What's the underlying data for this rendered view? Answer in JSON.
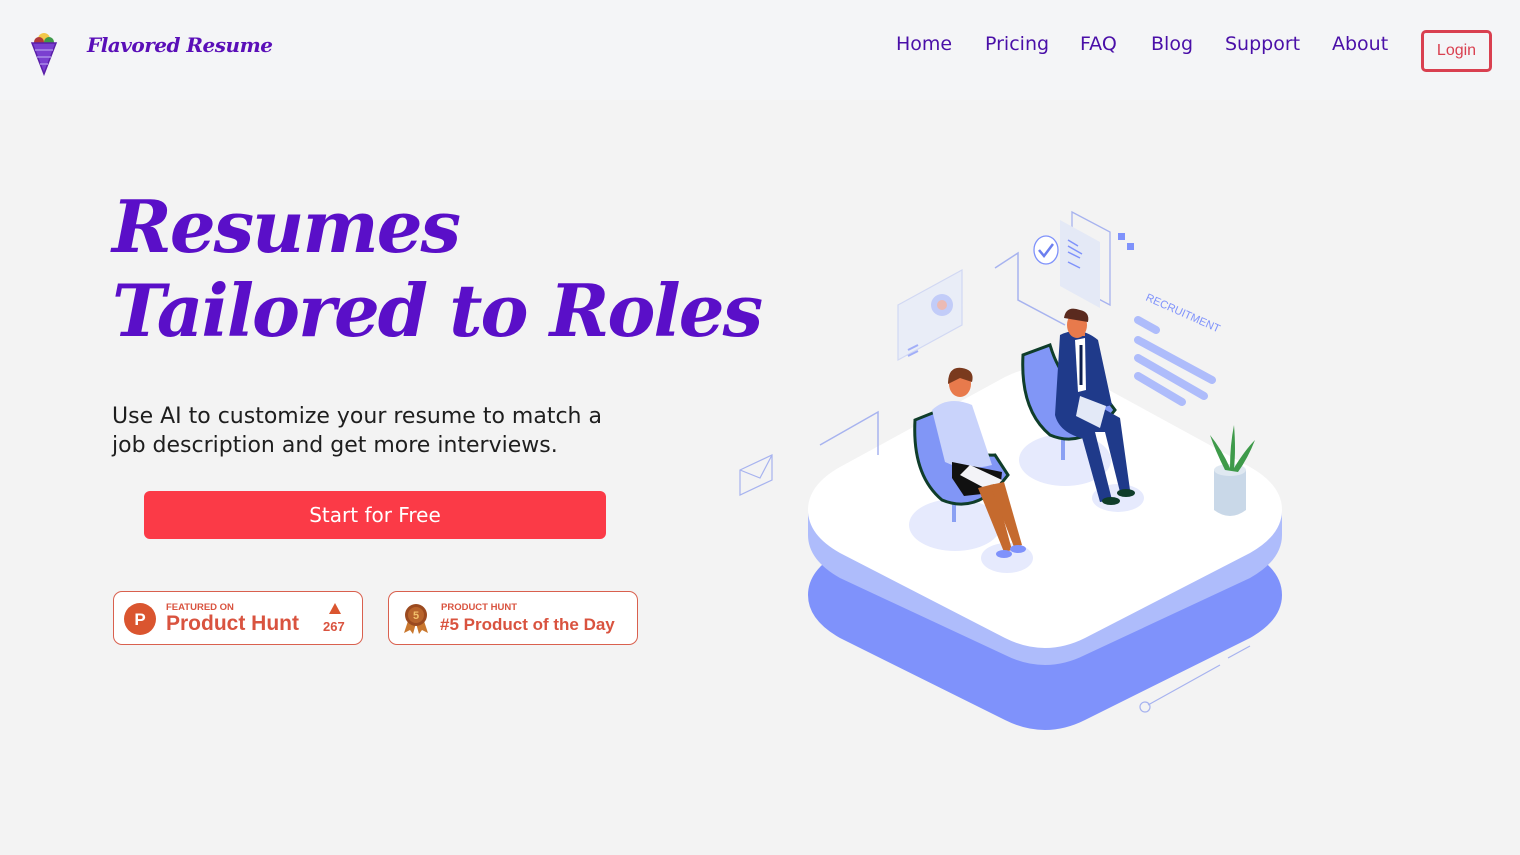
{
  "header": {
    "brand": "Flavored Resume",
    "nav": [
      {
        "label": "Home"
      },
      {
        "label": "Pricing"
      },
      {
        "label": "FAQ"
      },
      {
        "label": "Blog"
      },
      {
        "label": "Support"
      },
      {
        "label": "About"
      }
    ],
    "login_label": "Login"
  },
  "hero": {
    "title_line1": "Resumes",
    "title_line2": "Tailored to Roles",
    "subtitle_line1": "Use AI to customize your resume to match a",
    "subtitle_line2": "job description and get more interviews.",
    "cta_label": "Start for Free"
  },
  "badges": {
    "featured": {
      "small": "FEATURED ON",
      "big": "Product Hunt",
      "icon_letter": "P",
      "upvotes": "267"
    },
    "potd": {
      "small": "PRODUCT HUNT",
      "big": "#5 Product of the Day",
      "medal_number": "5"
    }
  },
  "illustration": {
    "label": "RECRUITMENT"
  },
  "colors": {
    "brand_purple": "#5a0fc8",
    "nav_purple": "#4a0fa8",
    "cta_red": "#fb3a47",
    "login_red": "#d94050",
    "ph_red": "#d9533f",
    "platform_blue": "#7f92fb"
  }
}
